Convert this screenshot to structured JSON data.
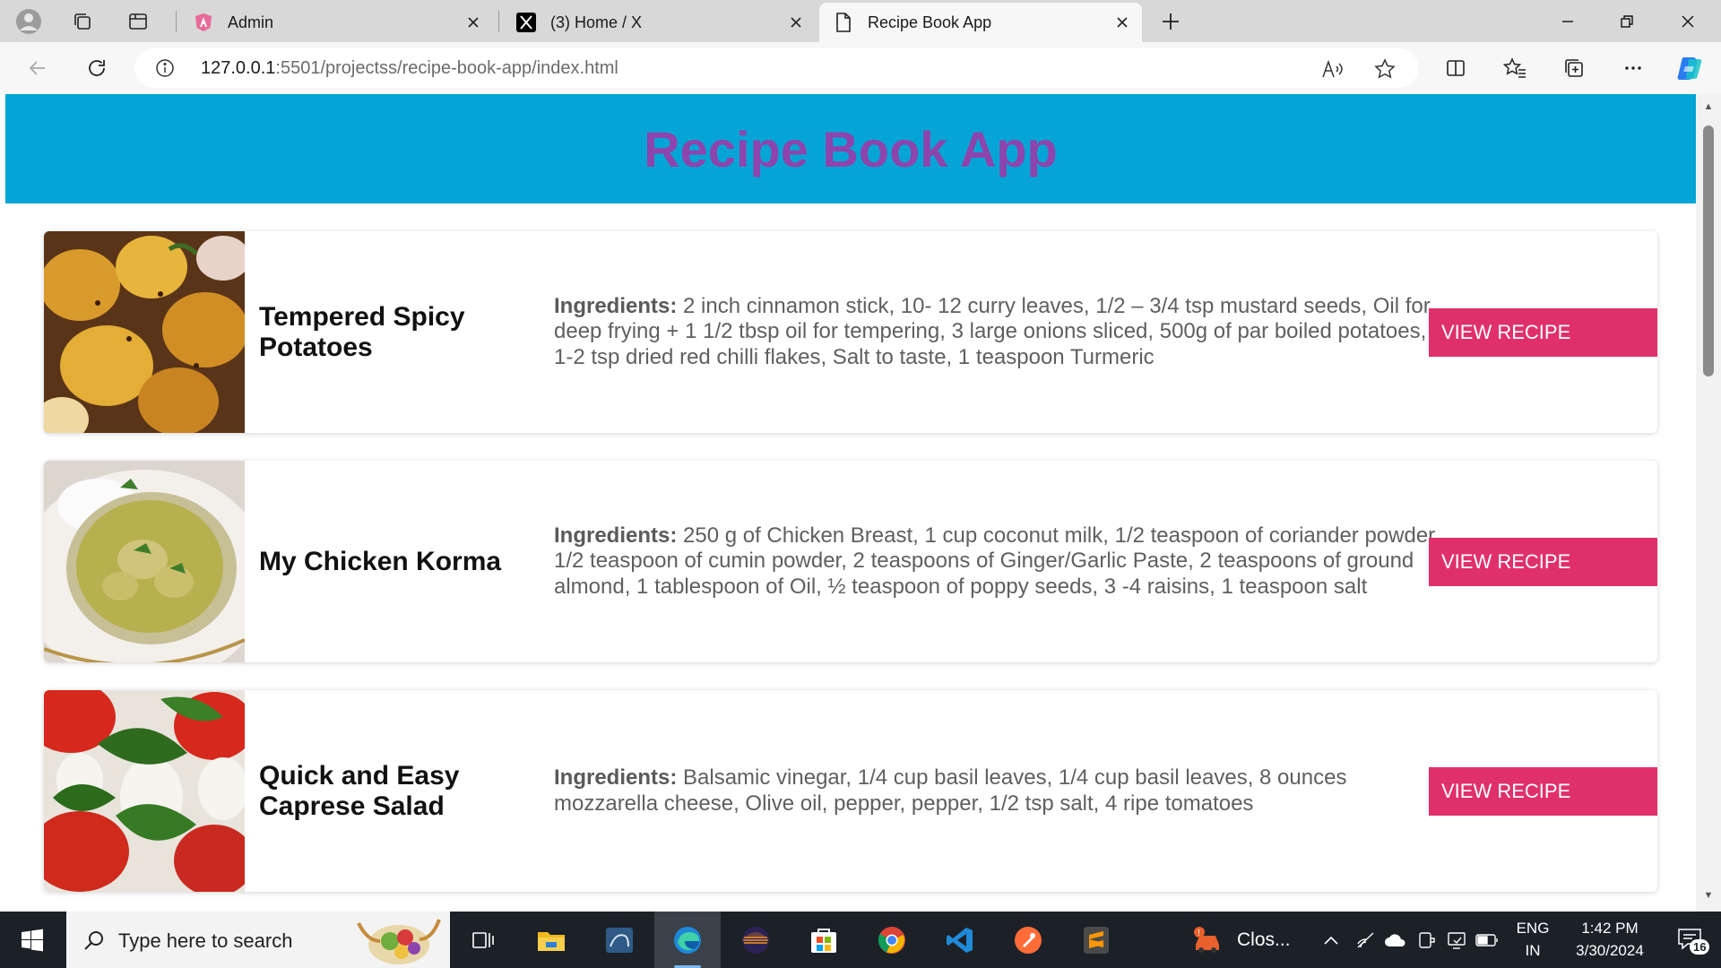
{
  "browser": {
    "tabs": [
      {
        "label": "Admin"
      },
      {
        "label": "(3) Home / X"
      },
      {
        "label": "Recipe Book App"
      }
    ],
    "address": {
      "host": "127.0.0.1",
      "rest": ":5501/projectss/recipe-book-app/index.html"
    }
  },
  "page": {
    "title": "Recipe Book App",
    "ingredients_label": "Ingredients:",
    "recipes": [
      {
        "name": "Tempered Spicy Potatoes",
        "ingredients": "2 inch cinnamon stick, 10- 12 curry leaves, 1/2 – 3/4 tsp mustard seeds, Oil for deep frying + 1 1/2 tbsp oil for tempering, 3 large onions sliced, 500g of par boiled potatoes, 1-2 tsp dried red chilli flakes, Salt to taste, 1 teaspoon Turmeric",
        "button": "VIEW RECIPE"
      },
      {
        "name": "My Chicken Korma",
        "ingredients": "250 g of Chicken Breast, 1 cup coconut milk, 1/2 teaspoon of coriander powder, 1/2 teaspoon of cumin powder, 2 teaspoons of Ginger/Garlic Paste, 2 teaspoons of ground almond, 1 tablespoon of Oil, ½ teaspoon of poppy seeds, 3 -4 raisins, 1 teaspoon salt",
        "button": "VIEW RECIPE"
      },
      {
        "name": "Quick and Easy Caprese Salad",
        "ingredients": "Balsamic vinegar, 1/4 cup basil leaves, 1/4 cup basil leaves, 8 ounces mozzarella cheese, Olive oil, pepper, pepper, 1/2 tsp salt, 4 ripe tomatoes",
        "button": "VIEW RECIPE"
      }
    ]
  },
  "taskbar": {
    "search_placeholder": "Type here to search",
    "notification_app": "Clos...",
    "language": {
      "line1": "ENG",
      "line2": "IN"
    },
    "clock": {
      "time": "1:42 PM",
      "date": "3/30/2024"
    },
    "notification_count": "16"
  },
  "colors": {
    "header_bg": "#04a5d6",
    "title": "#8e44ad",
    "button_bg": "#e0306b"
  }
}
